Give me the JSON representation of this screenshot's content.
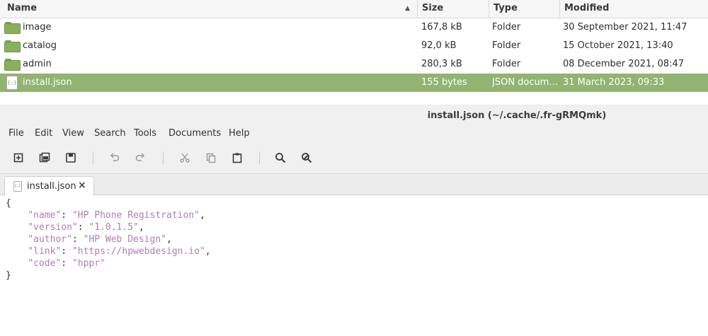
{
  "file_list": {
    "columns": {
      "name": "Name",
      "size": "Size",
      "type": "Type",
      "modified": "Modified"
    },
    "sort_indicator": "▲",
    "rows": [
      {
        "name": "image",
        "size": "167,8 kB",
        "type": "Folder",
        "modified": "30 September 2021, 11:47",
        "icon": "folder-icon"
      },
      {
        "name": "catalog",
        "size": "92,0 kB",
        "type": "Folder",
        "modified": "15 October 2021, 13:40",
        "icon": "folder-icon"
      },
      {
        "name": "admin",
        "size": "280,3 kB",
        "type": "Folder",
        "modified": "08 December 2021, 08:47",
        "icon": "folder-icon"
      },
      {
        "name": "install.json",
        "size": "155 bytes",
        "type": "JSON docum…",
        "modified": "31 March 2023, 09:33",
        "icon": "json-file-icon",
        "selected": true
      }
    ],
    "selection_color": "#92b372"
  },
  "editor": {
    "window_title": "install.json (~/.cache/.fr-gRMQmk)",
    "menu": [
      "File",
      "Edit",
      "View",
      "Search",
      "Tools",
      "Documents",
      "Help"
    ],
    "toolbar": [
      "new-document-icon",
      "open-icon",
      "save-icon",
      "undo-icon",
      "redo-icon",
      "cut-icon",
      "copy-icon",
      "paste-icon",
      "find-icon",
      "find-replace-icon"
    ],
    "tab": {
      "label": "install.json",
      "close": "×",
      "icon_text": "{;}"
    },
    "code": {
      "open_brace": "{",
      "close_brace": "}",
      "entries": [
        {
          "key": "\"name\"",
          "value": "\"HP Phone Registration\"",
          "trail": ","
        },
        {
          "key": "\"version\"",
          "value": "\"1.0.1.5\"",
          "trail": ","
        },
        {
          "key": "\"author\"",
          "value": "\"HP Web Design\"",
          "trail": ","
        },
        {
          "key": "\"link\"",
          "value": "\"https://hpwebdesign.io\"",
          "trail": ","
        },
        {
          "key": "\"code\"",
          "value": "\"hppr\"",
          "trail": ""
        }
      ],
      "string_color": "#b07eb0"
    }
  }
}
